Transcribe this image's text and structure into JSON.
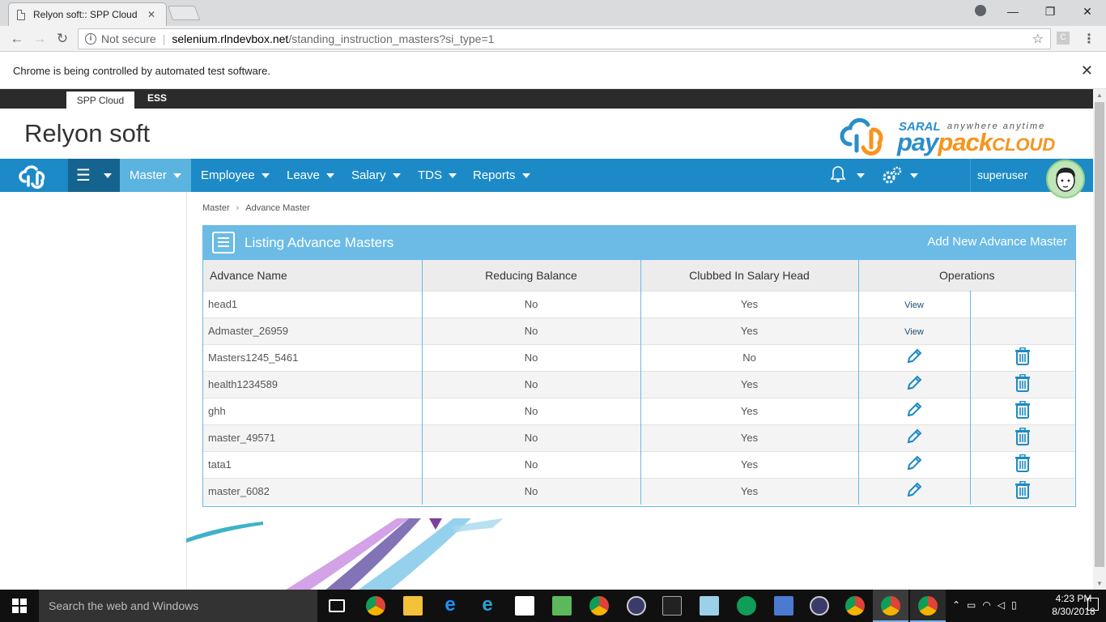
{
  "browser": {
    "tab_title": "Relyon soft:: SPP Cloud",
    "not_secure": "Not secure",
    "url_host": "selenium.rlndevbox.net",
    "url_path": "/standing_instruction_masters?si_type=1",
    "infobar_text": "Chrome is being controlled by automated test software."
  },
  "app": {
    "top_tabs": [
      "SPP Cloud",
      "ESS"
    ],
    "brand_title": "Relyon soft",
    "logo": {
      "saral": "SARAL",
      "tagline": "anywhere anytime",
      "pay": "pay",
      "pack": "pack",
      "cloud": "CLOUD"
    },
    "nav": [
      "Master",
      "Employee",
      "Leave",
      "Salary",
      "TDS",
      "Reports"
    ],
    "active_nav": "Master",
    "user": "superuser"
  },
  "breadcrumb": [
    "Master",
    "Advance Master"
  ],
  "panel": {
    "title": "Listing Advance Masters",
    "add_label": "Add New Advance Master",
    "columns": [
      "Advance Name",
      "Reducing Balance",
      "Clubbed In Salary Head",
      "Operations"
    ],
    "view_label": "View",
    "rows": [
      {
        "name": "head1",
        "reducing": "No",
        "clubbed": "Yes",
        "ops": "view"
      },
      {
        "name": "Admaster_26959",
        "reducing": "No",
        "clubbed": "Yes",
        "ops": "view"
      },
      {
        "name": "Masters1245_5461",
        "reducing": "No",
        "clubbed": "No",
        "ops": "edit"
      },
      {
        "name": "health1234589",
        "reducing": "No",
        "clubbed": "Yes",
        "ops": "edit"
      },
      {
        "name": "ghh",
        "reducing": "No",
        "clubbed": "Yes",
        "ops": "edit"
      },
      {
        "name": "master_49571",
        "reducing": "No",
        "clubbed": "Yes",
        "ops": "edit"
      },
      {
        "name": "tata1",
        "reducing": "No",
        "clubbed": "Yes",
        "ops": "edit"
      },
      {
        "name": "master_6082",
        "reducing": "No",
        "clubbed": "Yes",
        "ops": "edit"
      }
    ]
  },
  "taskbar": {
    "search_placeholder": "Search the web and Windows",
    "time": "4:23 PM",
    "date": "8/30/2018"
  },
  "colors": {
    "nav_blue": "#1c8ac6",
    "active_nav": "#5bb3e0",
    "panel_head": "#6bbbe6",
    "icon_blue": "#1c8ac6"
  }
}
